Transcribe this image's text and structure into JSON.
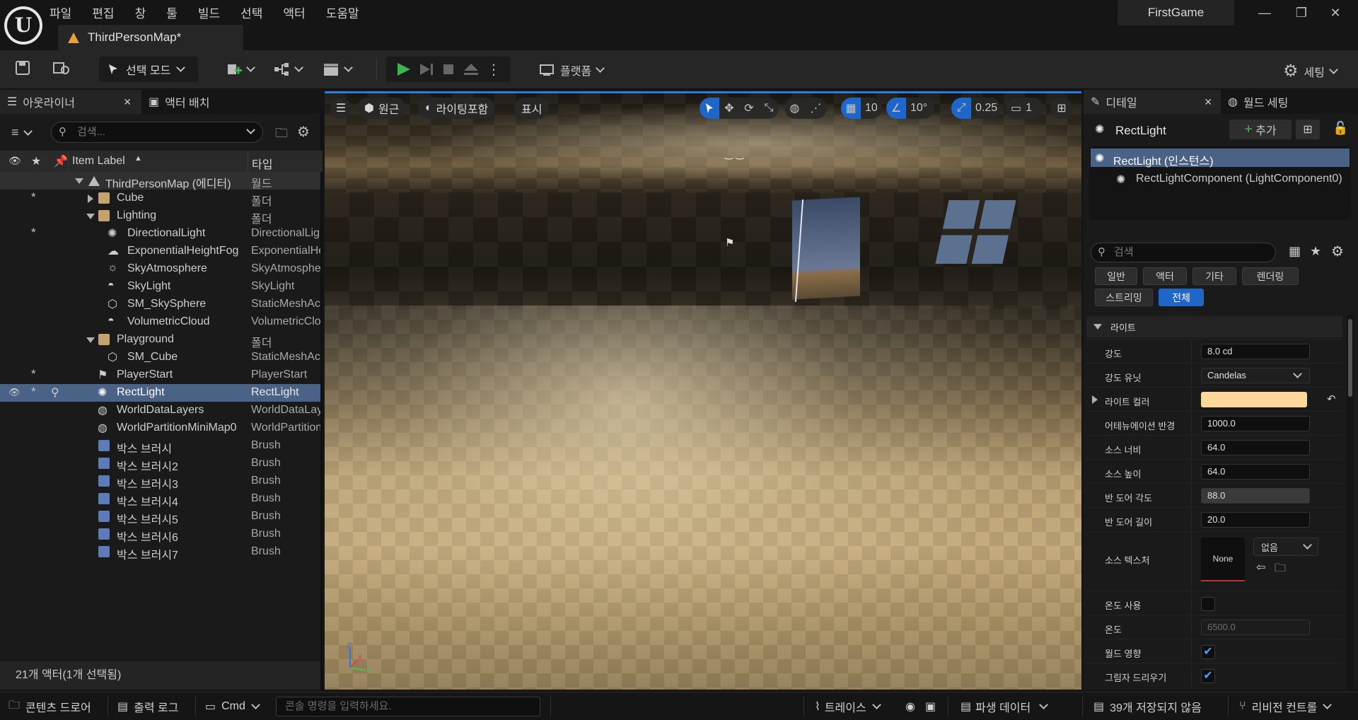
{
  "menu": [
    "파일",
    "편집",
    "창",
    "툴",
    "빌드",
    "선택",
    "액터",
    "도움말"
  ],
  "project_name": "FirstGame",
  "map_tab": "ThirdPersonMap*",
  "toolbar": {
    "select_mode": "선택 모드",
    "platform": "플랫폼",
    "settings": "세팅"
  },
  "outliner": {
    "tab": "아웃라이너",
    "tab2": "액터 배치",
    "search_placeholder": "검색...",
    "col_label": "Item Label",
    "col_type": "타입",
    "rows": [
      {
        "label": "ThirdPersonMap (에디터)",
        "type": "월드"
      },
      {
        "label": "Cube",
        "type": "폴더"
      },
      {
        "label": "Lighting",
        "type": "폴더"
      },
      {
        "label": "DirectionalLight",
        "type": "DirectionalLight"
      },
      {
        "label": "ExponentialHeightFog",
        "type": "ExponentialHeightFog"
      },
      {
        "label": "SkyAtmosphere",
        "type": "SkyAtmosphere"
      },
      {
        "label": "SkyLight",
        "type": "SkyLight"
      },
      {
        "label": "SM_SkySphere",
        "type": "StaticMeshActor"
      },
      {
        "label": "VolumetricCloud",
        "type": "VolumetricCloud"
      },
      {
        "label": "Playground",
        "type": "폴더"
      },
      {
        "label": "SM_Cube",
        "type": "StaticMeshActor"
      },
      {
        "label": "PlayerStart",
        "type": "PlayerStart"
      },
      {
        "label": "RectLight",
        "type": "RectLight"
      },
      {
        "label": "WorldDataLayers",
        "type": "WorldDataLayers"
      },
      {
        "label": "WorldPartitionMiniMap0",
        "type": "WorldPartitionMiniMap"
      },
      {
        "label": "박스 브러시",
        "type": "Brush"
      },
      {
        "label": "박스 브러시2",
        "type": "Brush"
      },
      {
        "label": "박스 브러시3",
        "type": "Brush"
      },
      {
        "label": "박스 브러시4",
        "type": "Brush"
      },
      {
        "label": "박스 브러시5",
        "type": "Brush"
      },
      {
        "label": "박스 브러시6",
        "type": "Brush"
      },
      {
        "label": "박스 브러시7",
        "type": "Brush"
      }
    ],
    "footer": "21개 액터(1개 선택됨)"
  },
  "viewport": {
    "perspective": "원근",
    "lighting": "라이팅포함",
    "show": "표시",
    "grid": "10",
    "angle": "10°",
    "scale": "0.25",
    "camera": "1"
  },
  "details": {
    "tab": "디테일",
    "tab2": "월드 세팅",
    "actor": "RectLight",
    "add": "추가",
    "instance": "RectLight (인스턴스)",
    "component": "RectLightComponent (LightComponent0)",
    "search_placeholder": "검색",
    "filters": [
      "일반",
      "액터",
      "기타",
      "렌더링",
      "스트리밍",
      "전체"
    ],
    "section": "라이트",
    "props": {
      "intensity_label": "강도",
      "intensity": "8.0 cd",
      "units_label": "강도 유닛",
      "units": "Candelas",
      "color_label": "라이트 컬러",
      "atten_label": "어테뉴에이션 반경",
      "atten": "1000.0",
      "srcw_label": "소스 너비",
      "srcw": "64.0",
      "srch_label": "소스 높이",
      "srch": "64.0",
      "barn_angle_label": "반 도어 각도",
      "barn_angle": "88.0",
      "barn_len_label": "반 도어 길이",
      "barn_len": "20.0",
      "texture_label": "소스 텍스처",
      "texture": "None",
      "texture_combo": "없음",
      "use_temp_label": "온도 사용",
      "temp_label": "온도",
      "temp": "6500.0",
      "affects_world_label": "월드 영향",
      "cast_shadows_label": "그림자 드리우기"
    },
    "light_color": "#ffd79a"
  },
  "bottom": {
    "content_drawer": "콘텐츠 드로어",
    "output_log": "출력 로그",
    "cmd": "Cmd",
    "console_placeholder": "콘솔 명령을 입력하세요.",
    "trace": "트레이스",
    "derived": "파생 데이터",
    "unsaved": "39개 저장되지 않음",
    "revision": "리비전 컨트롤"
  }
}
